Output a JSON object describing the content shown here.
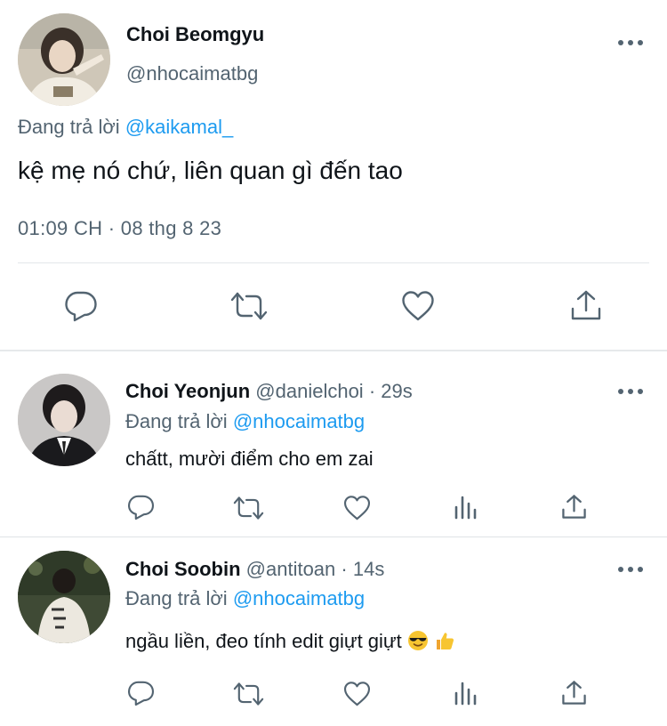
{
  "main_tweet": {
    "author_name": "Choi Beomgyu",
    "author_handle": "@nhocaimatbg",
    "reply_prefix": "Đang trả lời",
    "reply_mention": "@kaikamal_",
    "text": "kệ mẹ nó chứ, liên quan gì đến tao",
    "timestamp": "01:09 CH · 08 thg 8 23",
    "actions": [
      "reply-icon",
      "retweet-icon",
      "like-icon",
      "share-icon"
    ]
  },
  "replies": [
    {
      "author_name": "Choi Yeonjun",
      "author_handle": "@danielchoi",
      "time": "· 29s",
      "reply_prefix": "Đang trả lời",
      "reply_mention": "@nhocaimatbg",
      "text": "chấtt, mười điểm cho em zai",
      "emojis": []
    },
    {
      "author_name": "Choi Soobin",
      "author_handle": "@antitoan",
      "time": "· 14s",
      "reply_prefix": "Đang trả lời",
      "reply_mention": "@nhocaimatbg",
      "text": "ngầu liền, đeo tính edit giựt giựt",
      "emojis": [
        "smiling-face-with-sunglasses",
        "thumbs-up"
      ]
    }
  ],
  "colors": {
    "text": "#0f1419",
    "secondary": "#536471",
    "link": "#1d9bf0",
    "divider": "#e3e7ea"
  }
}
